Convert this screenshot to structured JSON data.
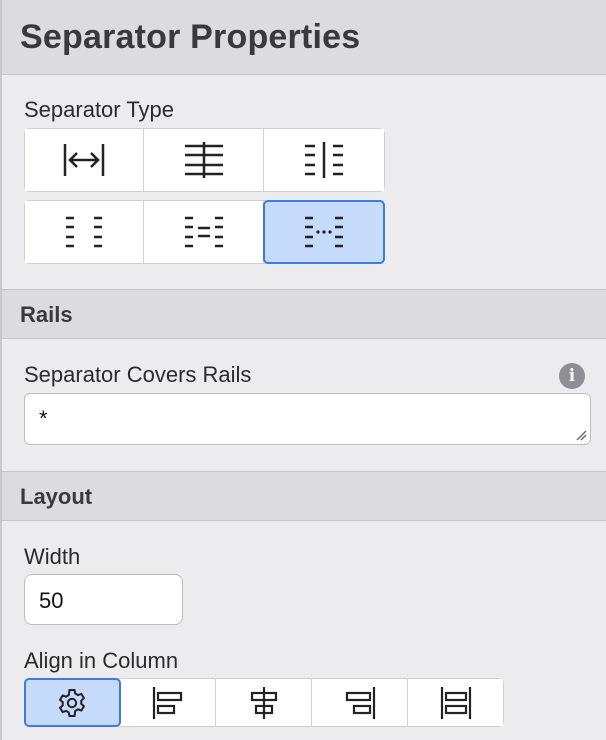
{
  "panel": {
    "title": "Separator Properties"
  },
  "separator_type": {
    "label": "Separator Type",
    "options": [
      {
        "icon": "arrows-between-bars-icon"
      },
      {
        "icon": "horizontal-rule-lines-icon"
      },
      {
        "icon": "dashed-solid-dashed-icon"
      },
      {
        "icon": "dashed-columns-icon"
      },
      {
        "icon": "dashed-equals-icon"
      },
      {
        "icon": "dashed-dots-icon",
        "selected": true
      }
    ]
  },
  "rails": {
    "section_title": "Rails",
    "covers_label": "Separator Covers Rails",
    "covers_value": "*",
    "info_icon": "i"
  },
  "layout": {
    "section_title": "Layout",
    "width_label": "Width",
    "width_value": "50",
    "align_label": "Align in Column",
    "align_options": [
      {
        "icon": "gear-icon",
        "selected": true
      },
      {
        "icon": "align-left-icon"
      },
      {
        "icon": "align-center-icon"
      },
      {
        "icon": "align-right-icon"
      },
      {
        "icon": "align-justify-icon"
      }
    ]
  },
  "colors": {
    "accent": "#3f7ae0",
    "selected_fill": "#c6dafc",
    "header_bg": "#dcdcdf",
    "panel_bg": "#ececee"
  }
}
